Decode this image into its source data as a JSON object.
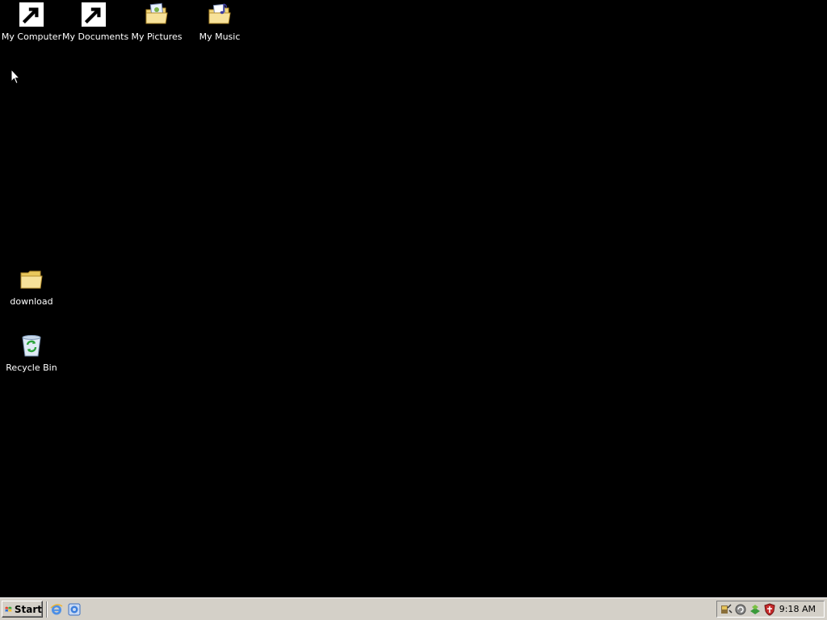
{
  "desktop": {
    "background_color": "#000000",
    "icons": [
      {
        "label": "My Computer",
        "icon": "computer-icon"
      },
      {
        "label": "My Documents",
        "icon": "documents-folder-icon"
      },
      {
        "label": "My Pictures",
        "icon": "pictures-folder-icon"
      },
      {
        "label": "My Music",
        "icon": "music-folder-icon"
      },
      {
        "label": "download",
        "icon": "folder-icon"
      },
      {
        "label": "Recycle Bin",
        "icon": "recycle-bin-icon"
      }
    ]
  },
  "taskbar": {
    "start_label": "Start",
    "quick_launch": [
      {
        "icon": "internet-explorer-icon"
      },
      {
        "icon": "ie-shortcut-icon"
      }
    ],
    "tray_icons": [
      {
        "icon": "network-tool-icon"
      },
      {
        "icon": "update-icon"
      },
      {
        "icon": "security-center-icon"
      },
      {
        "icon": "antivirus-shield-icon"
      }
    ],
    "clock": "9:18 AM"
  }
}
